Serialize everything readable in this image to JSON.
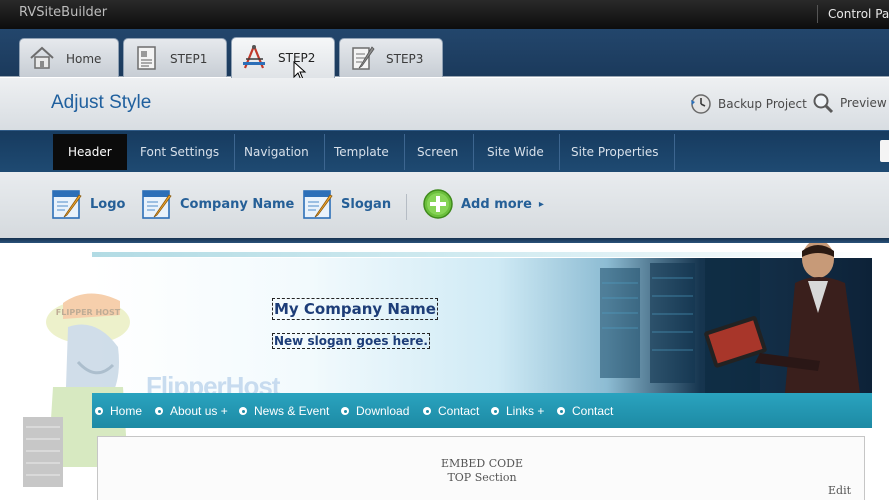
{
  "app": {
    "title": "RVSiteBuilder",
    "control_panel": "Control Pan"
  },
  "tabs": [
    {
      "label": "Home",
      "icon": "home-icon"
    },
    {
      "label": "STEP1",
      "icon": "document-icon"
    },
    {
      "label": "STEP2",
      "icon": "design-tools-icon",
      "active": true
    },
    {
      "label": "STEP3",
      "icon": "edit-page-icon"
    }
  ],
  "page": {
    "title": "Adjust Style"
  },
  "actions": {
    "backup": "Backup Project",
    "preview": "Preview"
  },
  "subnav": {
    "items": [
      "Header",
      "Font Settings",
      "Navigation",
      "Template",
      "Screen",
      "Site Wide",
      "Site Properties"
    ],
    "active": "Header"
  },
  "elements": {
    "logo": "Logo",
    "company": "Company Name",
    "slogan": "Slogan",
    "add_more": "Add more",
    "add_more_arrow": "▸"
  },
  "site": {
    "company_name": "My Company Name",
    "slogan": "New slogan goes here.",
    "logo_text": "FlipperHost",
    "mascot_cap_text": "FLIPPER HOST",
    "menu": [
      "Home",
      "About us +",
      "News & Event",
      "Download",
      "Contact",
      "Links +",
      "Contact"
    ],
    "embed_line1": "EMBED CODE",
    "embed_line2": "TOP Section",
    "edit_link": "Edit"
  },
  "colors": {
    "tabbar": "#1f4267",
    "subnav": "#1a4168",
    "title_blue": "#20609e",
    "menu_teal": "#2298b3",
    "add_green": "#6bbf3c"
  }
}
